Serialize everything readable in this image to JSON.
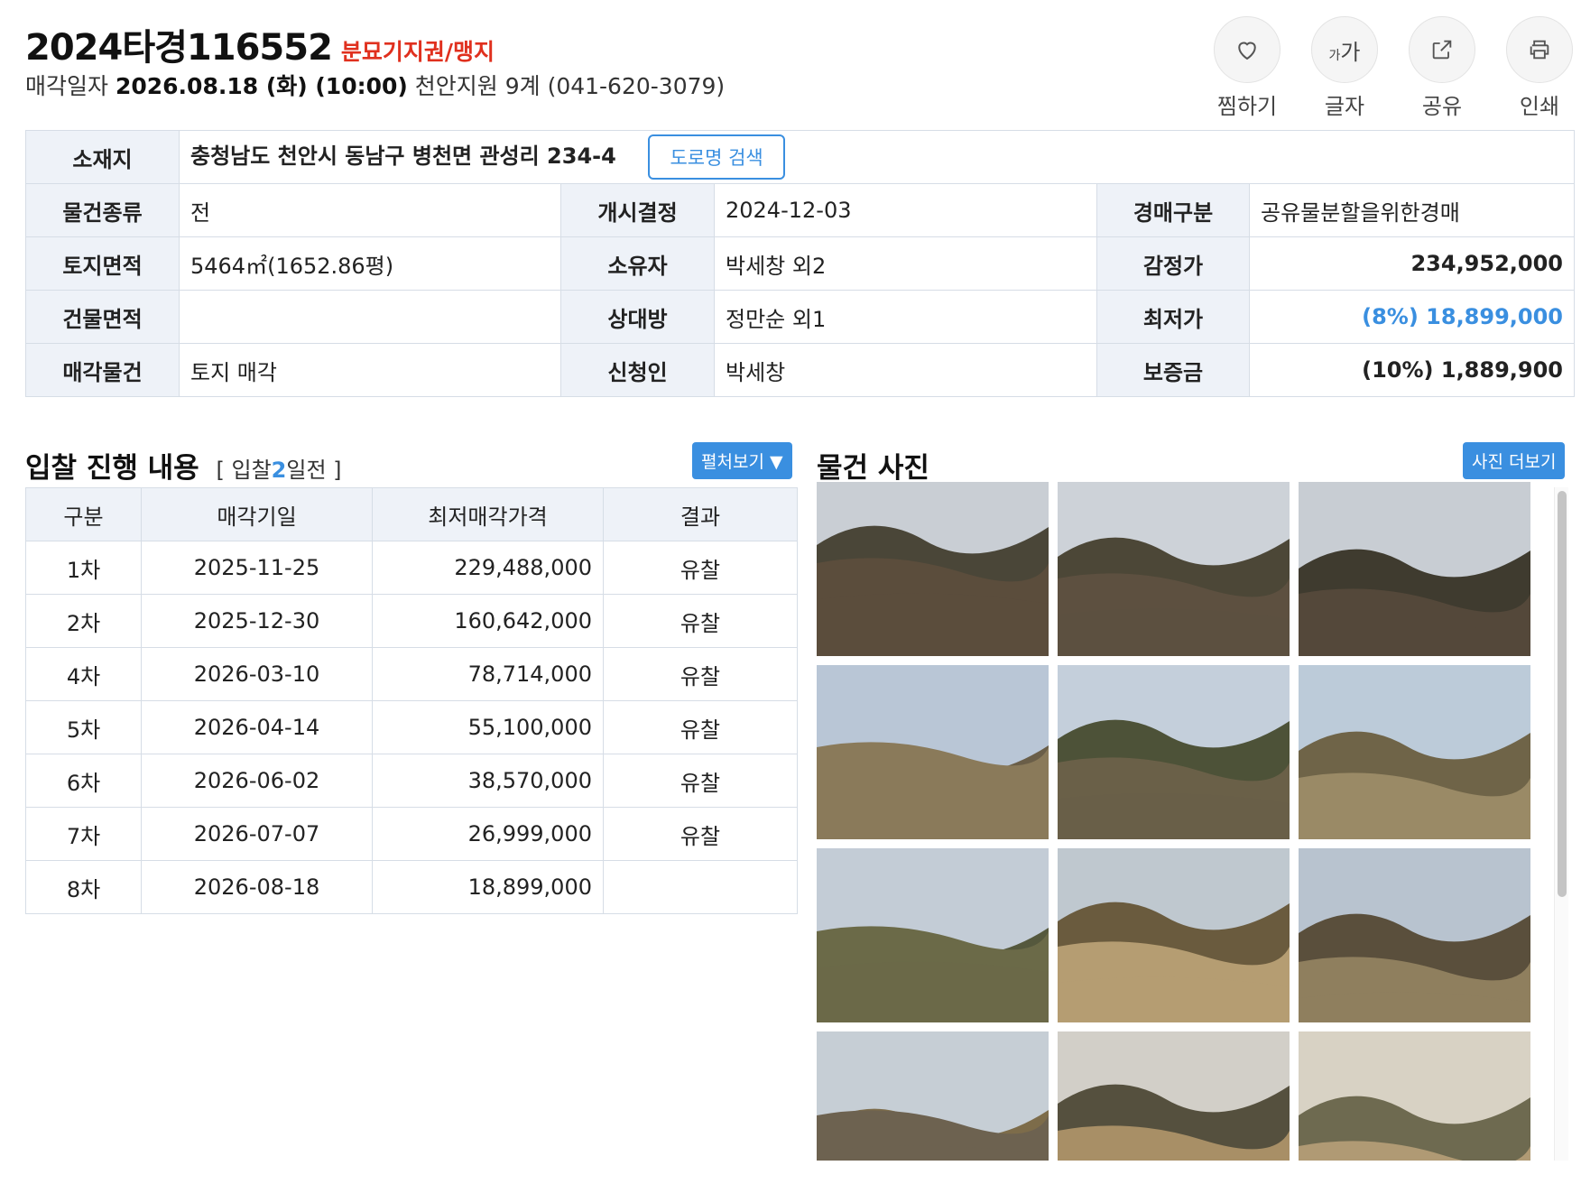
{
  "header": {
    "case_number": "2024타경116552",
    "tags": "분묘기지권/맹지",
    "sale_label": "매각일자",
    "sale_datetime": "2026.08.18 (화) (10:00)",
    "court": "천안지원 9계 (041-620-3079)"
  },
  "actions": [
    {
      "label": "찜하기",
      "icon": "heart-icon"
    },
    {
      "label": "글자",
      "icon": "font-size-icon"
    },
    {
      "label": "공유",
      "icon": "share-icon"
    },
    {
      "label": "인쇄",
      "icon": "print-icon"
    }
  ],
  "font_glyph": {
    "small": "가",
    "large": "가"
  },
  "info": {
    "address_label": "소재지",
    "address": "충청남도 천안시 동남구 병천면 관성리 234-4",
    "road_search": "도로명 검색",
    "rows": [
      {
        "l1": "물건종류",
        "v1": "전",
        "l2": "개시결정",
        "v2": "2024-12-03",
        "l3": "경매구분",
        "v3": "공유물분할을위한경매"
      },
      {
        "l1": "토지면적",
        "v1": "5464㎡(1652.86평)",
        "l2": "소유자",
        "v2": "박세창 외2",
        "l3": "감정가",
        "v3": "234,952,000"
      },
      {
        "l1": "건물면적",
        "v1": "",
        "l2": "상대방",
        "v2": "정만순 외1",
        "l3": "최저가",
        "v3": "(8%) 18,899,000"
      },
      {
        "l1": "매각물건",
        "v1": "토지 매각",
        "l2": "신청인",
        "v2": "박세창",
        "l3": "보증금",
        "v3": "(10%) 1,889,900"
      }
    ]
  },
  "bids": {
    "title": "입찰 진행 내용",
    "note_prefix": "[ 입찰",
    "note_days": "2",
    "note_suffix": "일전 ]",
    "expand_button": "펼처보기 ▼",
    "columns": [
      "구분",
      "매각기일",
      "최저매각가격",
      "결과"
    ],
    "rows": [
      [
        "1차",
        "2025-11-25",
        "229,488,000",
        "유찰"
      ],
      [
        "2차",
        "2025-12-30",
        "160,642,000",
        "유찰"
      ],
      [
        "4차",
        "2026-03-10",
        "78,714,000",
        "유찰"
      ],
      [
        "5차",
        "2026-04-14",
        "55,100,000",
        "유찰"
      ],
      [
        "6차",
        "2026-06-02",
        "38,570,000",
        "유찰"
      ],
      [
        "7차",
        "2026-07-07",
        "26,999,000",
        "유찰"
      ],
      [
        "8차",
        "2026-08-18",
        "18,899,000",
        ""
      ]
    ]
  },
  "photos": {
    "title": "물건 사진",
    "more_button": "사진 더보기",
    "count": 12
  },
  "colors": {
    "accent_blue": "#3a8fe0",
    "tag_red": "#e0301e",
    "header_cell": "#eef2f8",
    "border": "#d6dde6"
  }
}
